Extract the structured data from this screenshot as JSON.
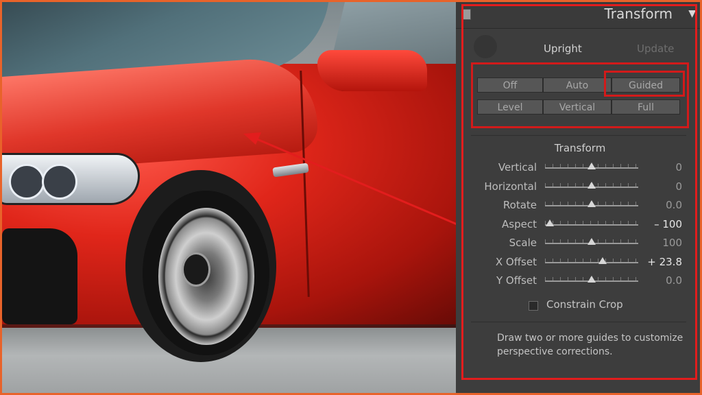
{
  "panel": {
    "title": "Transform",
    "collapse_icon": "triangle-down-icon",
    "upright": {
      "label": "Upright",
      "update_label": "Update",
      "buttons_row1": [
        "Off",
        "Auto",
        "Guided"
      ],
      "buttons_row2": [
        "Level",
        "Vertical",
        "Full"
      ],
      "active": "Guided"
    },
    "transform_section_title": "Transform",
    "sliders": [
      {
        "label": "Vertical",
        "value": "0",
        "position": 0.5
      },
      {
        "label": "Horizontal",
        "value": "0",
        "position": 0.5
      },
      {
        "label": "Rotate",
        "value": "0.0",
        "position": 0.5
      },
      {
        "label": "Aspect",
        "value": "– 100",
        "position": 0.05
      },
      {
        "label": "Scale",
        "value": "100",
        "position": 0.5
      },
      {
        "label": "X Offset",
        "value": "+ 23.8",
        "position": 0.62
      },
      {
        "label": "Y Offset",
        "value": "0.0",
        "position": 0.5
      }
    ],
    "constrain_crop": {
      "label": "Constrain Crop",
      "checked": false
    },
    "hint": "Draw two or more guides to customize perspective corrections."
  },
  "colors": {
    "highlight_red": "#e21d1d",
    "frame_orange": "#e8632a",
    "panel_bg": "#3d3d3d"
  }
}
